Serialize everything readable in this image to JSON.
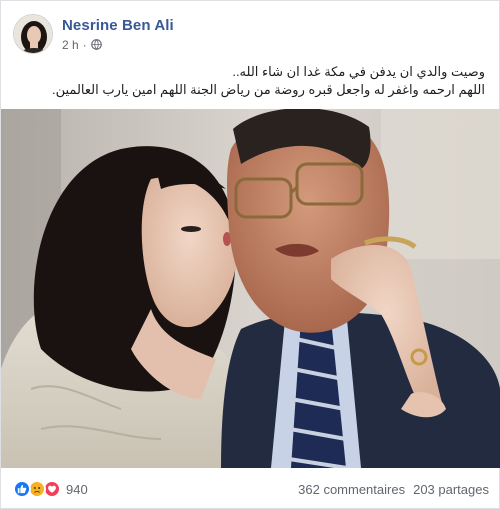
{
  "post": {
    "author": "Nesrine Ben Ali",
    "time": "2 h",
    "separator": "·",
    "privacy_icon": "globe-icon",
    "text_lines": [
      "وصيت والدي ان يدفن في مكة غدا ان شاء الله..",
      "اللهم ارحمه واغفر له واجعل قبره روضة من رياض الجنة اللهم امين يارب العالمين."
    ]
  },
  "reactions": {
    "icons": [
      "like-icon",
      "sad-icon",
      "love-icon"
    ],
    "count": "940"
  },
  "stats": {
    "comments": "362 commentaires",
    "shares": "203 partages"
  },
  "colors": {
    "author": "#385898",
    "meta": "#616770",
    "like": "#1877f2",
    "sad": "#f7b125",
    "love": "#f33e58"
  }
}
